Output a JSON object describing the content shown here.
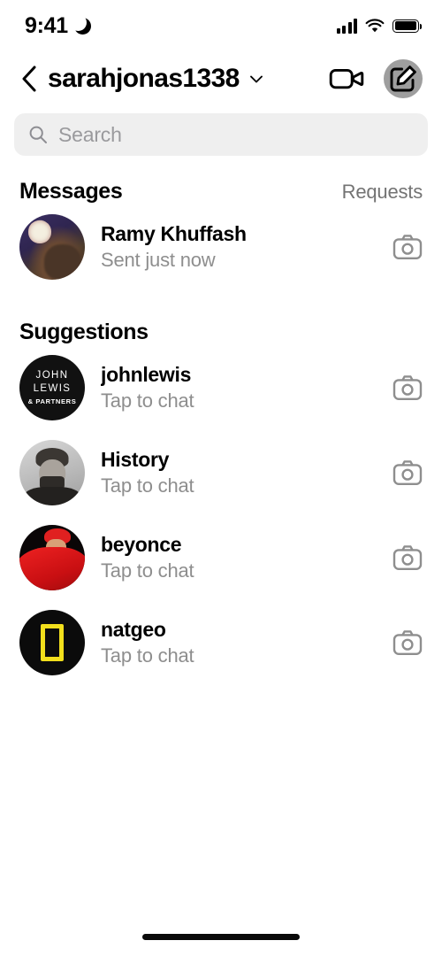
{
  "status_bar": {
    "time": "9:41",
    "dnd_icon": "crescent-moon-icon",
    "signal_icon": "cellular-signal-icon",
    "wifi_icon": "wifi-icon",
    "battery_icon": "battery-full-icon"
  },
  "header": {
    "back_icon": "back-chevron-icon",
    "title": "sarahjonas1338",
    "dropdown_icon": "chevron-down-icon",
    "video_call_icon": "video-camera-icon",
    "compose_icon": "compose-message-icon"
  },
  "search": {
    "icon": "search-icon",
    "placeholder": "Search",
    "value": ""
  },
  "messages_section": {
    "title": "Messages",
    "action": "Requests",
    "items": [
      {
        "name": "Ramy Khuffash",
        "subtitle": "Sent just now",
        "avatar": "photo-indoor-portrait",
        "action_icon": "camera-icon"
      }
    ]
  },
  "suggestions_section": {
    "title": "Suggestions",
    "items": [
      {
        "name": "johnlewis",
        "subtitle": "Tap to chat",
        "avatar": "john-lewis-logo",
        "logo_line1": "JOHN",
        "logo_line2": "LEWIS",
        "logo_line3": "& PARTNERS",
        "action_icon": "camera-icon"
      },
      {
        "name": "History",
        "subtitle": "Tap to chat",
        "avatar": "lincoln-portrait",
        "action_icon": "camera-icon"
      },
      {
        "name": "beyonce",
        "subtitle": "Tap to chat",
        "avatar": "beyonce-red-portrait",
        "action_icon": "camera-icon"
      },
      {
        "name": "natgeo",
        "subtitle": "Tap to chat",
        "avatar": "national-geographic-logo",
        "action_icon": "camera-icon"
      }
    ]
  },
  "home_indicator": "home-indicator",
  "colors": {
    "background": "#ffffff",
    "primary_text": "#000000",
    "secondary_text": "#8e8e8e",
    "search_field": "#efefef",
    "natgeo_yellow": "#f2df1c",
    "beyonce_red": "#ef2222"
  }
}
